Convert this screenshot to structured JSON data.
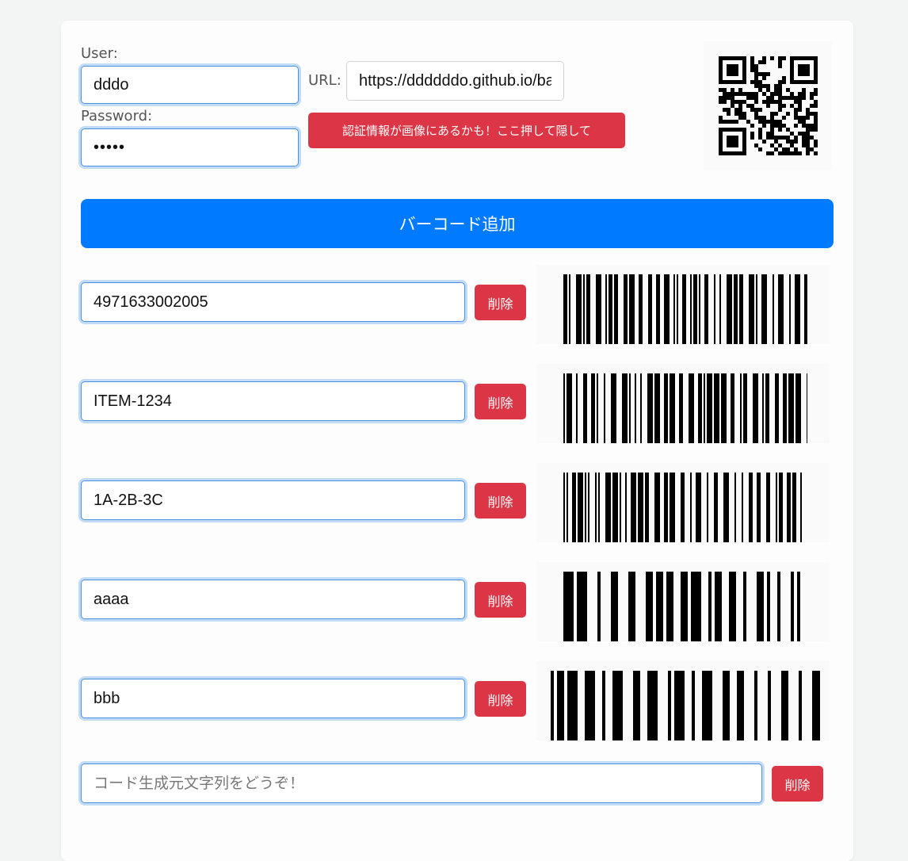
{
  "auth": {
    "user_label": "User:",
    "user_value": "dddo",
    "password_label": "Password:",
    "password_value": "•••••",
    "url_label": "URL:",
    "url_value": "https://ddddddo.github.io/ba",
    "hide_button": "認証情報が画像にあるかも！ここ押して隠して"
  },
  "add_button": "バーコード追加",
  "delete_label": "削除",
  "barcodes": [
    {
      "value": "4971633002005"
    },
    {
      "value": "ITEM-1234"
    },
    {
      "value": "1A-2B-3C"
    },
    {
      "value": "aaaa"
    },
    {
      "value": "bbb"
    }
  ],
  "new_entry": {
    "placeholder": "コード生成元文字列をどうぞ！",
    "delete_label": "削除"
  },
  "colors": {
    "primary": "#007bff",
    "danger": "#dc3545",
    "focus_ring": "#c2dcf7"
  }
}
